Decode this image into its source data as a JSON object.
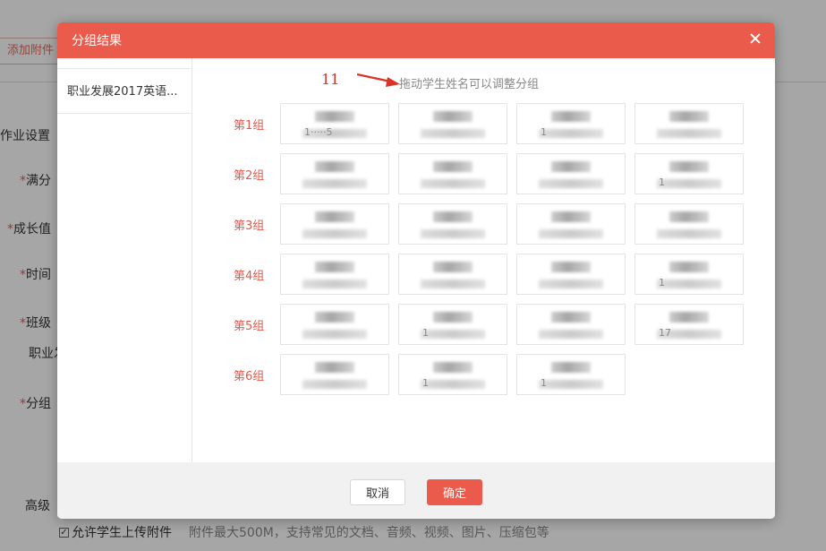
{
  "background": {
    "attach_button": "添加附件",
    "labels": {
      "homework_settings": "作业设置",
      "full_score": "满分",
      "growth_value": "成长值",
      "time": "时间",
      "class": "班级",
      "class_value": "职业发",
      "group": "分组",
      "advanced": "高级"
    },
    "required_mark": "*",
    "allow_upload_label": "允许学生上传附件",
    "allow_upload_checked": true,
    "upload_hint": "附件最大500M，支持常见的文档、音频、视频、图片、压缩包等"
  },
  "modal": {
    "title": "分组结果",
    "sidebar": {
      "items": [
        {
          "label": "职业发展2017英语..."
        }
      ]
    },
    "annotation_number": "11",
    "hint": "拖动学生姓名可以调整分组",
    "groups": [
      {
        "label": "第1组",
        "students": [
          {
            "id_hint": "1·····5"
          },
          {
            "id_hint": ""
          },
          {
            "id_hint": "1"
          },
          {
            "id_hint": ""
          }
        ]
      },
      {
        "label": "第2组",
        "students": [
          {
            "id_hint": ""
          },
          {
            "id_hint": ""
          },
          {
            "id_hint": ""
          },
          {
            "id_hint": "1"
          }
        ]
      },
      {
        "label": "第3组",
        "students": [
          {
            "id_hint": ""
          },
          {
            "id_hint": ""
          },
          {
            "id_hint": ""
          },
          {
            "id_hint": ""
          }
        ]
      },
      {
        "label": "第4组",
        "students": [
          {
            "id_hint": ""
          },
          {
            "id_hint": ""
          },
          {
            "id_hint": ""
          },
          {
            "id_hint": "1"
          }
        ]
      },
      {
        "label": "第5组",
        "students": [
          {
            "id_hint": ""
          },
          {
            "id_hint": "1"
          },
          {
            "id_hint": ""
          },
          {
            "id_hint": "17"
          }
        ]
      },
      {
        "label": "第6组",
        "students": [
          {
            "id_hint": ""
          },
          {
            "id_hint": "1"
          },
          {
            "id_hint": "1"
          }
        ]
      }
    ],
    "cancel_label": "取消",
    "ok_label": "确定"
  },
  "colors": {
    "accent": "#ea5b4c",
    "group_label": "#e0584b",
    "annotation": "#d9332a"
  },
  "icons": {
    "close": "close-icon",
    "annotation_arrow": "arrow-icon"
  }
}
